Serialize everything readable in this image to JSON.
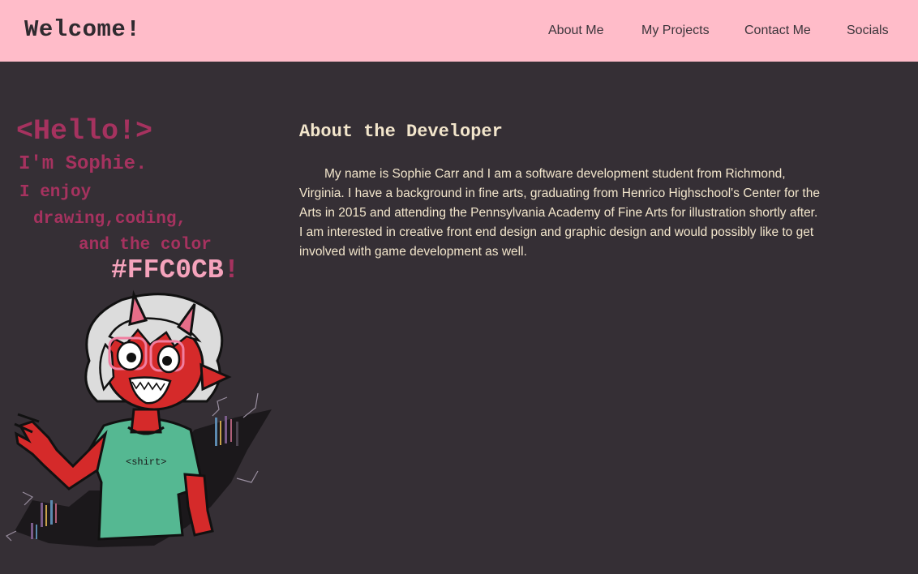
{
  "header": {
    "brand": "Welcome!",
    "nav": [
      {
        "label": "About Me"
      },
      {
        "label": "My Projects"
      },
      {
        "label": "Contact Me"
      },
      {
        "label": "Socials"
      }
    ]
  },
  "hero": {
    "hello": "<Hello!>",
    "line1": "I'm Sophie.",
    "line2": "I enjoy",
    "line3": "drawing,coding,",
    "line4": "and the color",
    "color_text": "#FFC0CB",
    "color_bang": "!",
    "shirt_text": "<shirt>"
  },
  "about": {
    "title": "About the Developer",
    "body": "My name is Sophie Carr and I am a software development student from Richmond, Virginia. I have a background in fine arts, graduating from Henrico Highschool's Center for the Arts in 2015 and attending the Pennsylvania Academy of Fine Arts for illustration shortly after. I am interested in creative front end design and graphic design and would possibly like to get involved with game development as well."
  },
  "colors": {
    "navbar_bg": "#ffbcc9",
    "page_bg": "#352f35",
    "hero_text": "#a6325f",
    "hero_accent": "#f5a3bc",
    "about_text": "#f3e6cc"
  }
}
